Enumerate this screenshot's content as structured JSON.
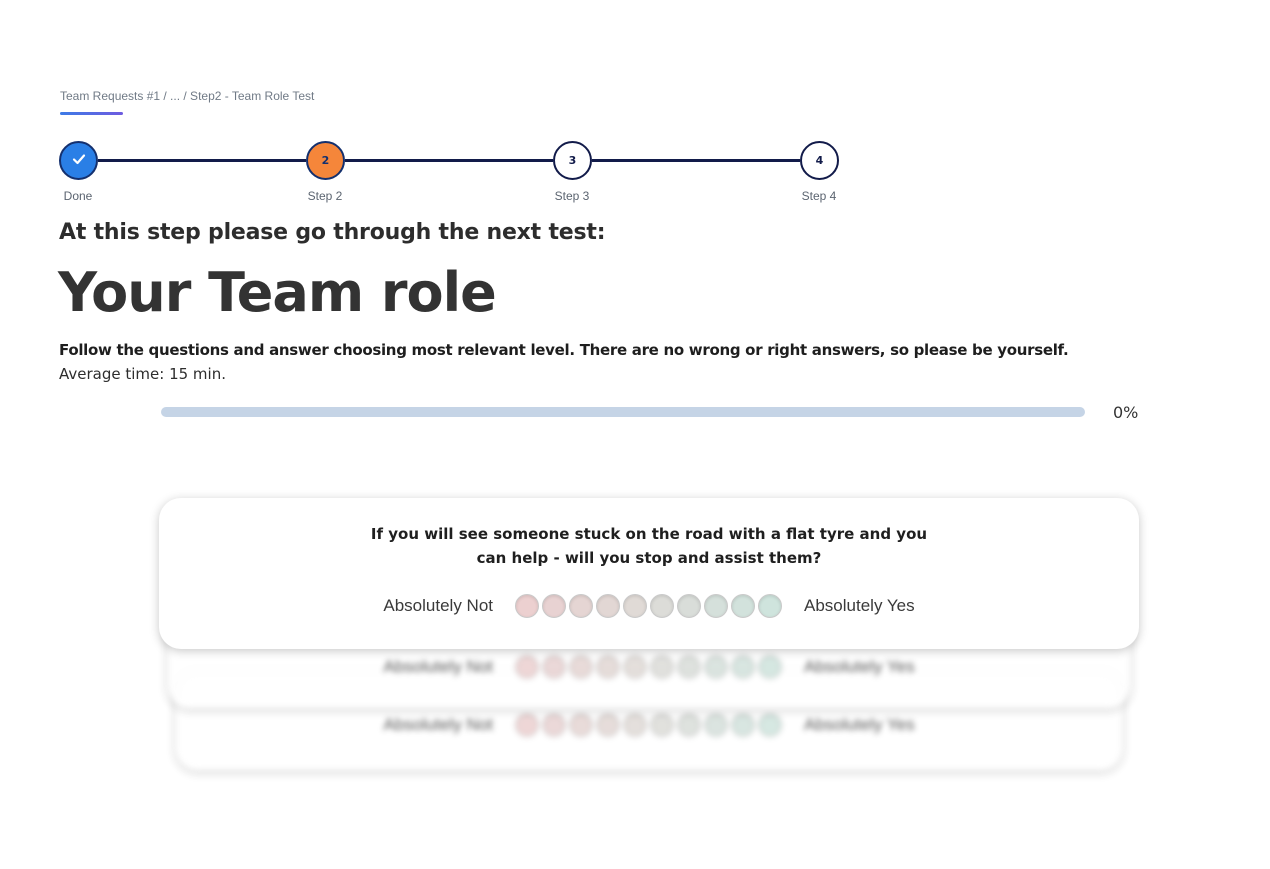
{
  "breadcrumb": "Team Requests #1 / ... / Step2 - Team Role Test",
  "steps": [
    {
      "label": "Done",
      "number": "",
      "state": "done",
      "icon": "check-icon"
    },
    {
      "label": "Step 2",
      "number": "2",
      "state": "current"
    },
    {
      "label": "Step 3",
      "number": "3",
      "state": "upcoming"
    },
    {
      "label": "Step 4",
      "number": "4",
      "state": "upcoming"
    }
  ],
  "header": {
    "subtitle": "At this step please go through the next test:",
    "title": "Your Team role",
    "instructions": "Follow the questions and answer choosing most relevant level. There  are no wrong or right answers, so please be yourself.",
    "avg_time": "Average time: 15 min."
  },
  "progress": {
    "value": 0,
    "label": "0%"
  },
  "question_card": {
    "question": "If you will see someone stuck on the road with a flat tyre and you can help - will you stop and assist them?",
    "scale_min_label": "Absolutely Not",
    "scale_max_label": "Absolutely Yes",
    "scale_colors": [
      "#ecd0d0",
      "#e8d2d2",
      "#e5d5d3",
      "#e2d7d4",
      "#e0dad6",
      "#dcdcd8",
      "#d9ddd9",
      "#d5e0db",
      "#d2e2dc",
      "#cfe4dd"
    ]
  },
  "upcoming_cards": [
    {
      "scale_min_label": "Absolutely Not",
      "scale_max_label": "Absolutely Yes"
    },
    {
      "scale_min_label": "Absolutely Not",
      "scale_max_label": "Absolutely Yes"
    }
  ],
  "colors": {
    "accent": "#3d7be6",
    "done_step": "#2a7fe6",
    "current_step": "#f5863a",
    "step_line": "#121b4a",
    "progress_track": "#c5d4e6"
  }
}
